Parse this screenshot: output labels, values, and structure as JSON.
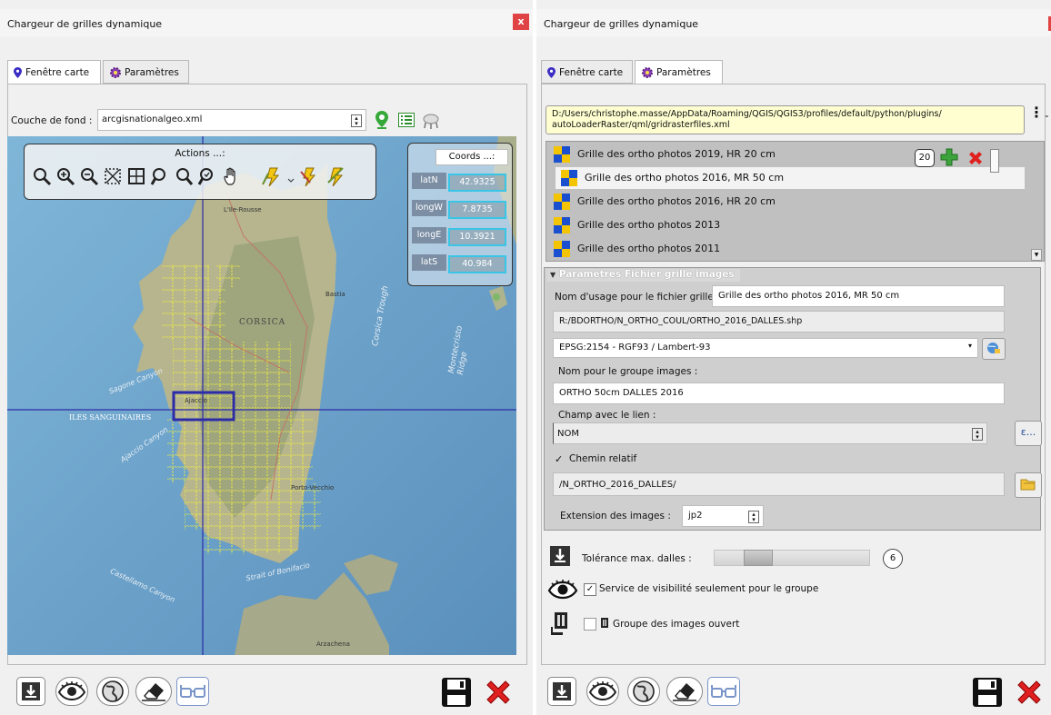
{
  "left": {
    "title": "Chargeur de grilles dynamique",
    "close": "x",
    "tabs": [
      {
        "label": "Fenêtre carte"
      },
      {
        "label": "Paramètres"
      }
    ],
    "basemap_label": "Couche de fond :",
    "basemap_value": "arcgisnationalgeo.xml",
    "actions_title": "Actions ...:",
    "coords_title": "Coords ...:",
    "coords": [
      {
        "label": "latN",
        "value": "42.9325"
      },
      {
        "label": "longW",
        "value": "7.8735"
      },
      {
        "label": "longE",
        "value": "10.3921"
      },
      {
        "label": "latS",
        "value": "40.984"
      }
    ],
    "map_labels": {
      "corsica": "CORSICA",
      "sanguinaires": "ILES SANGUINAIRES",
      "ajaccio": "Ajaccio",
      "sagone": "Sagone Canyon",
      "ajaccio_canyon": "Ajaccio Canyon",
      "corsica_trough": "Corsica Trough",
      "montecristo": "Montecristo Ridge",
      "bonifacio": "Strait of Bonifacio",
      "castellamo": "Castellamo Canyon",
      "bastia": "Bastia",
      "calvi": "L'Ile-Rousse",
      "porto_vecchio": "Porto-Vecchio",
      "arzachena": "Arzachena"
    }
  },
  "right": {
    "title": "Chargeur de grilles dynamique",
    "tabs": [
      {
        "label": "Fenêtre carte"
      },
      {
        "label": "Paramètres"
      }
    ],
    "path": "D:/Users/christophe.masse/AppData/Roaming/QGIS/QGIS3/profiles/default/python/plugins/\nautoLoaderRaster/qml/gridrasterfiles.xml",
    "grid_list": [
      {
        "label": "Grille des ortho photos 2019, HR 20 cm",
        "selected": false,
        "indent": false
      },
      {
        "label": "Grille des ortho photos 2016, MR 50 cm",
        "selected": true,
        "indent": true
      },
      {
        "label": "Grille des ortho photos 2016, HR 20 cm",
        "selected": false,
        "indent": false
      },
      {
        "label": "Grille des ortho photos 2013",
        "selected": false,
        "indent": false
      },
      {
        "label": "Grille des ortho photos 2011",
        "selected": false,
        "indent": false
      }
    ],
    "count": "20",
    "section_title": "Paramètres Fichier grille images",
    "usage_label": "Nom d'usage pour le fichier grille :",
    "usage_value": "Grille des ortho photos 2016, MR 50 cm",
    "shp_path": "R:/BDORTHO/N_ORTHO_COUL/ORTHO_2016_DALLES.shp",
    "crs": "EPSG:2154 - RGF93 / Lambert-93",
    "group_label": "Nom pour le groupe images :",
    "group_value": "ORTHO 50cm DALLES 2016",
    "field_label": "Champ avec le lien :",
    "field_value": "NOM",
    "expr_button": "ε...",
    "relative_label": "Chemin relatif",
    "relative_path": "/N_ORTHO_2016_DALLES/",
    "ext_label": "Extension des images :",
    "ext_value": "jp2",
    "tolerance_label": "Tolérance max. dalles :",
    "tolerance_value": "6",
    "visibility_label": "Service de visibilité seulement pour le groupe",
    "group_open_label": "Groupe des images ouvert"
  },
  "colors": {
    "accent": "#39c6e6",
    "selection": "#2c2ca8",
    "grid": "#f2ef3c",
    "close": "#e04343"
  }
}
